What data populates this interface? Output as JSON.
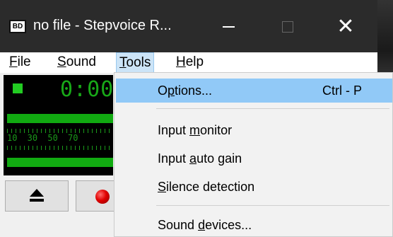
{
  "window": {
    "icon_text": "BD",
    "title": "no file - Stepvoice R...",
    "minimize_glyph": "",
    "maximize_glyph": "",
    "close_glyph": "✕"
  },
  "menubar": {
    "file": "File",
    "sound": "Sound",
    "tools": "Tools",
    "help": "Help"
  },
  "recorder": {
    "time": "0:00",
    "scale_labels": "10 30 50 70"
  },
  "tools_menu": {
    "options": {
      "label": "Options...",
      "accelerator": "Ctrl - P"
    },
    "input_monitor": "Input monitor",
    "input_auto_gain": "Input auto gain",
    "silence_detection": "Silence detection",
    "sound_devices": "Sound devices..."
  },
  "colors": {
    "titlebar": "#2b2b2b",
    "menu_highlight": "#91c9f7",
    "led_green": "#22cc22",
    "record_red": "#e00000"
  }
}
